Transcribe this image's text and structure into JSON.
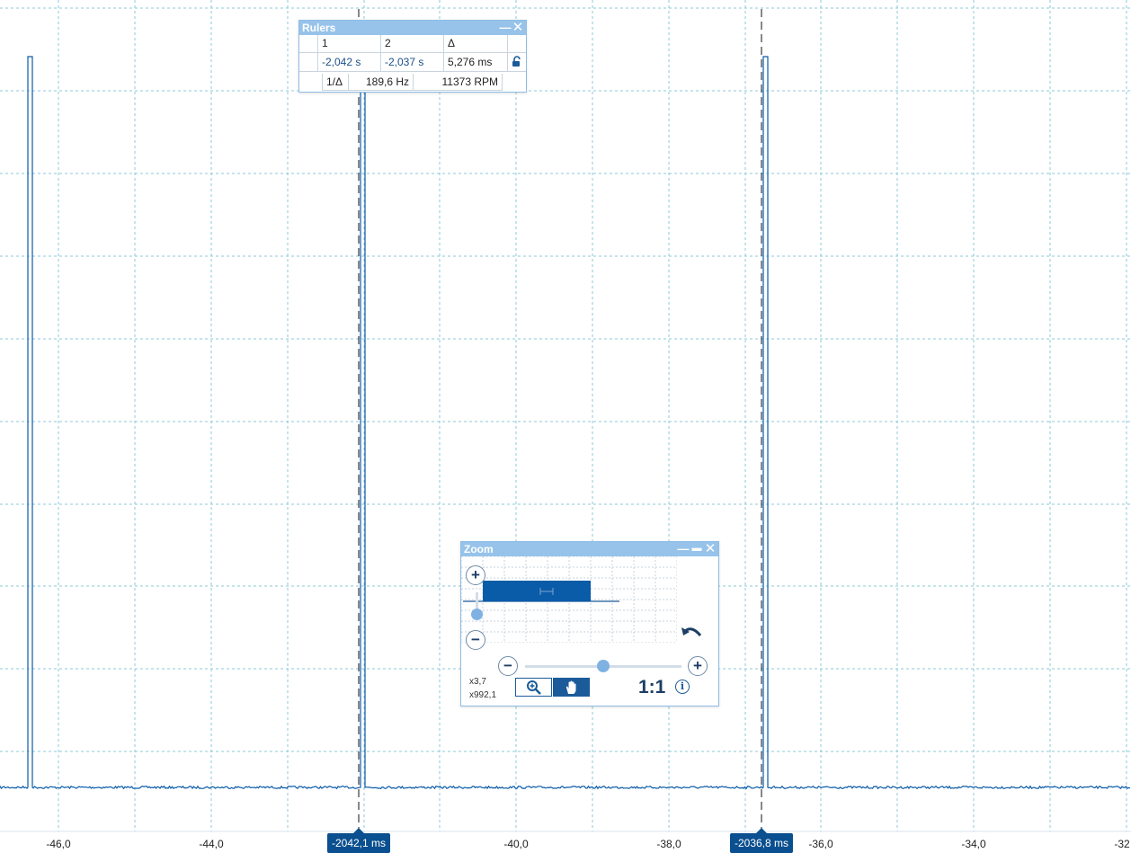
{
  "x_axis": {
    "ticks": [
      "-46,0",
      "-44,0",
      "-40,0",
      "-38,0",
      "-36,0",
      "-34,0",
      "-32"
    ]
  },
  "ruler_tags": [
    "-2042,1 ms",
    "-2036,8 ms"
  ],
  "rulers_panel": {
    "title": "Rulers",
    "headers": [
      "1",
      "2",
      "Δ"
    ],
    "values": [
      "-2,042 s",
      "-2,037 s",
      "5,276 ms"
    ],
    "inverse_label": "1/Δ",
    "frequency": "189,6 Hz",
    "rpm": "11373 RPM",
    "lock_icon": "unlock-icon"
  },
  "zoom_panel": {
    "title": "Zoom",
    "zoom_y": "x3,7",
    "zoom_x": "x992,1",
    "reset_label": "1:1",
    "icons": [
      "zoom-in-icon",
      "pan-hand-icon",
      "undo-icon",
      "info-icon"
    ]
  },
  "colors": {
    "signal": "#0a5ba8",
    "grid": "#8ec9d8",
    "panel_header": "#97c3ea",
    "ruler_tag": "#0a4f8f"
  }
}
